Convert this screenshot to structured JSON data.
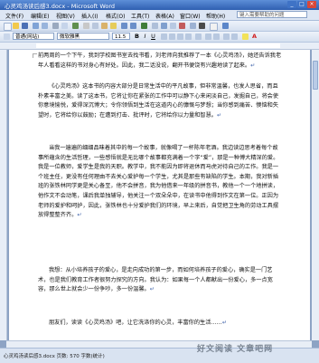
{
  "window": {
    "title": "心灵鸡汤读后感3.docx - Microsoft Word",
    "buttons": [
      "_",
      "□",
      "×"
    ]
  },
  "menu": {
    "items": [
      "文件(F)",
      "编辑(E)",
      "视图(V)",
      "插入(I)",
      "格式(O)",
      "工具(T)",
      "表格(A)",
      "窗口(W)",
      "帮助(H)"
    ],
    "help_placeholder": "键入需要帮助的问题"
  },
  "format_toolbar": {
    "style": "普通(网站)",
    "font": "微软雅黑",
    "size": "11.5",
    "bold": "B",
    "italic": "I",
    "underline": "U",
    "font_color": "A"
  },
  "document": {
    "paragraphs": [
      "前两周的一个下午，我到学校图书室去找书看，刘老师向我推荐了一本《心灵鸡汤》，她还告诉我老年人看看这样的书对身心有好处。因此，我二话没说，翻开书便饶有兴趣地读了起来。",
      "《心灵鸡汤》这本书的内容大部分是日常生活中的平凡故事，但非常温馨，也发人思省，而且朴素丰富之美。读了这本书，它将让你在紧张的工作中可以静下心来闲淡自己，发掘自己，将会使你意境愉悦，爱得深沉博大；令你领悟到生活在这道内心的慷慨与梦想；当你感到痛苦、懊恼和失望时，它将给你以鼓励；在遭到打击、批评时，它将给你以力量和智慧。",
      "当我一遍遍的细细品味着其中的每一个故事，就像喝了一杯陈年老酒。我边读边思考着每个故事所蕴含的生活哲理，一些感悟就是无比哪个故事都充满着一个字“爱”，那是一种博大精深的爱。我是一位教师，爱学生是我的天职。教学中，我不能因为即将退休而马虎对待自己的工作。我是一个班主任，更没有任何理由不去关心爱护每一个学生，尤其是那些有缺陷的学生。本期，我对新插班的张铁林同学更是关心备至，他不会拼音，我为他借来一年级的拼音书，教他一个一个地拼读，他作文不会动笔，课后我单独辅导，他关注一个双朵朵中，在读书中他得到作文在第一位。正因为老师的爱护和呵护，因此，张铁林也十分爱护我们的环境，早上来后，自觉把卫生角的劳动工具摆放得整整齐齐。",
      "我想：从小培养孩子的爱心，是走向成功的第一步，而如何培养孩子的爱心，确实是一门艺术，也是我们教育工作者很努力探究的方向。我认为：如果每一个人都献出一份爱心，多一点宽容，那么世上就会少一份争吵，多一份温馨。",
      "朋友们，读读《心灵鸡汤》吧，让它洗涤你的心灵，丰富你的生活……"
    ],
    "return_mark": "↵"
  },
  "status_bar": {
    "text": "心灵鸡汤读后感3.docx   页数: 570  字数(统计)"
  },
  "watermark": {
    "text": "好文阅读  文章吧网"
  }
}
